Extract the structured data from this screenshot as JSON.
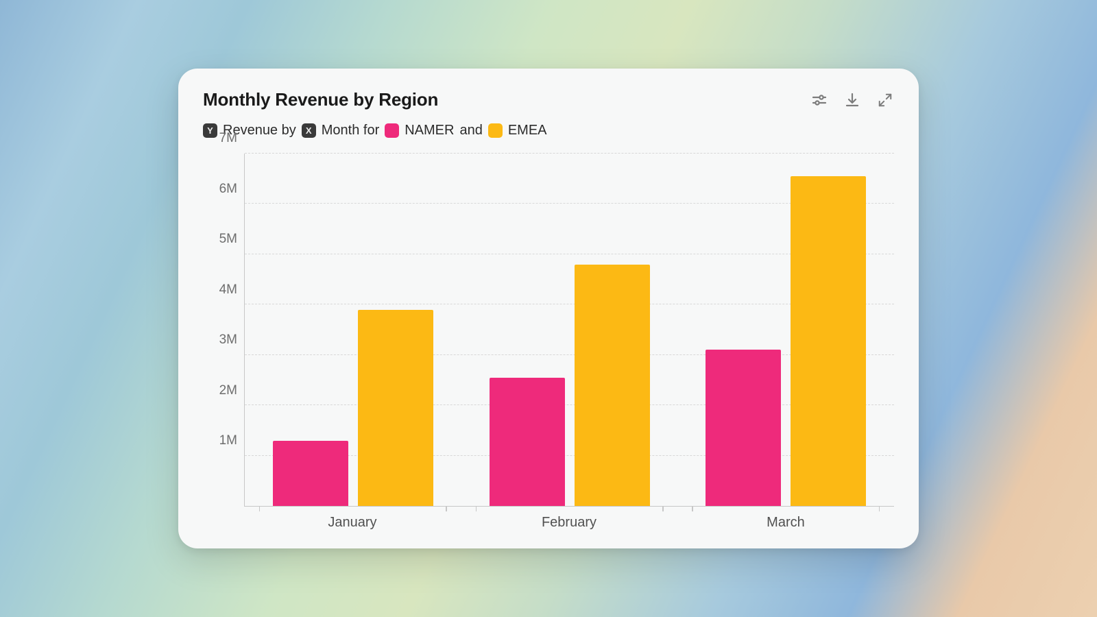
{
  "title": "Monthly Revenue by Region",
  "legend": {
    "y_badge": "Y",
    "y_text": "Revenue by",
    "x_badge": "X",
    "x_text": "Month for",
    "series1_label": "NAMER",
    "and_text": "and",
    "series2_label": "EMEA"
  },
  "colors": {
    "namer": "#ee2a7b",
    "emea": "#fcb914"
  },
  "y_ticks": [
    "1M",
    "2M",
    "3M",
    "4M",
    "5M",
    "6M",
    "7M"
  ],
  "x_labels": [
    "January",
    "February",
    "March"
  ],
  "chart_data": {
    "type": "bar",
    "title": "Monthly Revenue by Region",
    "xlabel": "Month",
    "ylabel": "Revenue",
    "ylim": [
      0,
      7000000
    ],
    "categories": [
      "January",
      "February",
      "March"
    ],
    "series": [
      {
        "name": "NAMER",
        "values": [
          1300000,
          2550000,
          3100000
        ]
      },
      {
        "name": "EMEA",
        "values": [
          3900000,
          4800000,
          6550000
        ]
      }
    ]
  }
}
